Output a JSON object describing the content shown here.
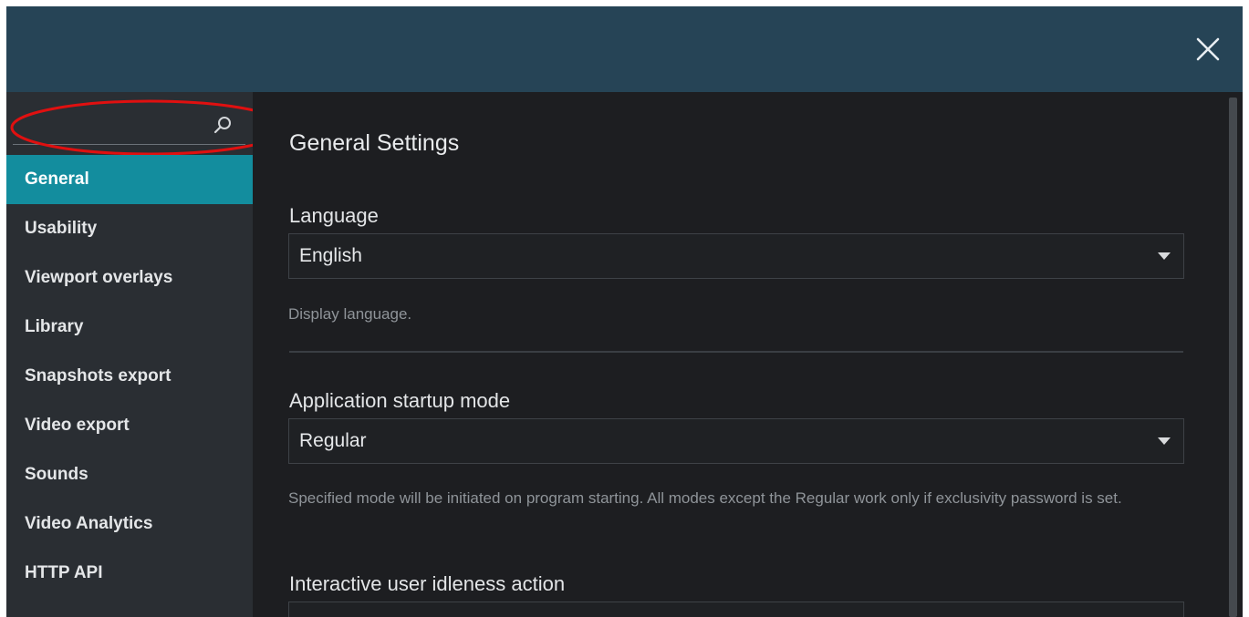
{
  "window": {
    "close_icon": "close-icon"
  },
  "search": {
    "value": "",
    "placeholder": "",
    "icon": "search-icon"
  },
  "sidebar": {
    "items": [
      {
        "label": "General",
        "active": true
      },
      {
        "label": "Usability",
        "active": false
      },
      {
        "label": "Viewport overlays",
        "active": false
      },
      {
        "label": "Library",
        "active": false
      },
      {
        "label": "Snapshots export",
        "active": false
      },
      {
        "label": "Video export",
        "active": false
      },
      {
        "label": "Sounds",
        "active": false
      },
      {
        "label": "Video Analytics",
        "active": false
      },
      {
        "label": "HTTP API",
        "active": false
      }
    ]
  },
  "main": {
    "title": "General Settings",
    "language": {
      "label": "Language",
      "value": "English",
      "hint": "Display language."
    },
    "startup": {
      "label": "Application startup mode",
      "value": "Regular",
      "hint": "Specified mode will be initiated on program starting. All modes except the Regular work only if exclusivity password is set."
    },
    "idleness": {
      "label": "Interactive user idleness action"
    }
  },
  "colors": {
    "titlebar": "#264456",
    "sidebar": "#2a2e33",
    "content": "#1d1e21",
    "accent": "#138d9e",
    "annotation": "#e01010"
  }
}
